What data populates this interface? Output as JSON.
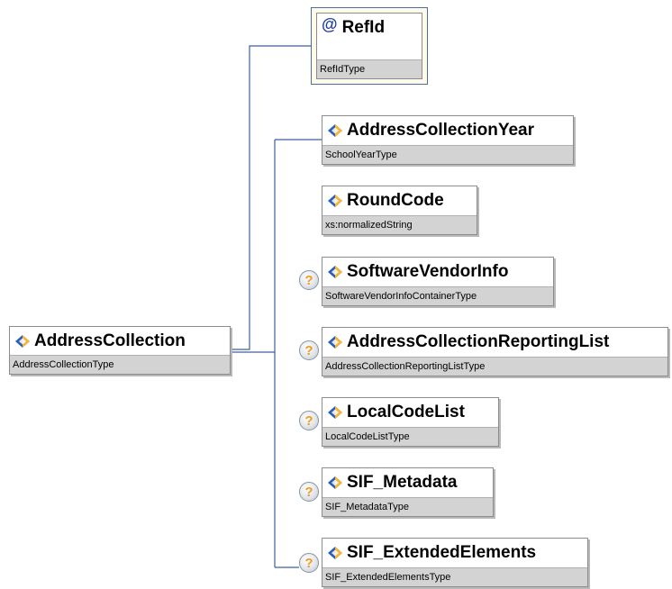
{
  "root": {
    "name": "AddressCollection",
    "type": "AddressCollectionType",
    "icon": "element-icon"
  },
  "attribute": {
    "symbol": "@",
    "name": "RefId",
    "type": "RefIdType"
  },
  "children": [
    {
      "name": "AddressCollectionYear",
      "type": "SchoolYearType",
      "optional": false,
      "icon": "element-icon"
    },
    {
      "name": "RoundCode",
      "type": "xs:normalizedString",
      "optional": false,
      "icon": "element-icon"
    },
    {
      "name": "SoftwareVendorInfo",
      "type": "SoftwareVendorInfoContainerType",
      "optional": true,
      "icon": "element-icon"
    },
    {
      "name": "AddressCollectionReportingList",
      "type": "AddressCollectionReportingListType",
      "optional": true,
      "icon": "element-icon"
    },
    {
      "name": "LocalCodeList",
      "type": "LocalCodeListType",
      "optional": true,
      "icon": "element-icon"
    },
    {
      "name": "SIF_Metadata",
      "type": "SIF_MetadataType",
      "optional": true,
      "icon": "element-icon"
    },
    {
      "name": "SIF_ExtendedElements",
      "type": "SIF_ExtendedElementsType",
      "optional": true,
      "icon": "element-icon"
    }
  ],
  "optional_marker": "?",
  "colors": {
    "connector": "#3f5f99",
    "type_bar": "#d3d3d3",
    "attribute_bg": "#fffbea",
    "optional_mark": "#f09a1e"
  }
}
